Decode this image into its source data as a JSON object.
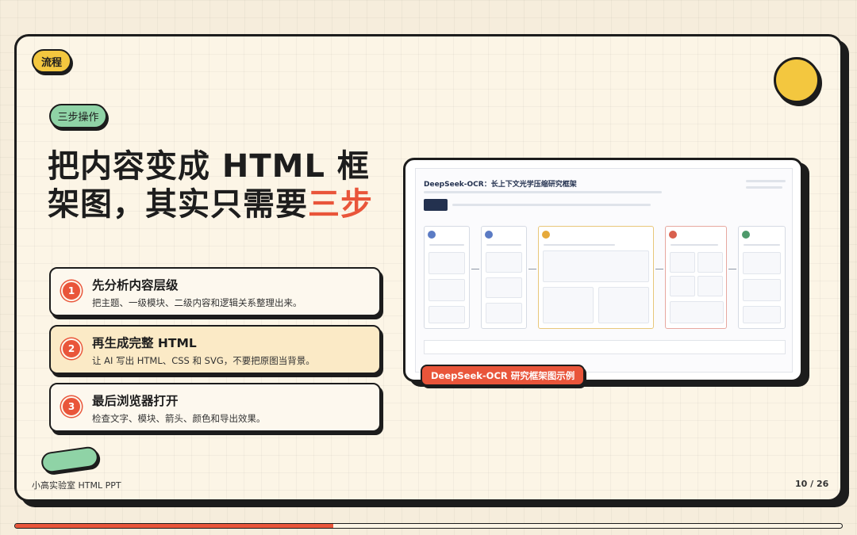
{
  "tag_label": "流程",
  "subtag_label": "三步操作",
  "headline": {
    "part1": "把内容变成 HTML 框架图，其实只需要",
    "accent": "三步"
  },
  "steps": [
    {
      "num": "1",
      "title": "先分析内容层级",
      "desc": "把主题、一级模块、二级内容和逻辑关系整理出来。"
    },
    {
      "num": "2",
      "title": "再生成完整 HTML",
      "desc": "让 AI 写出 HTML、CSS 和 SVG，不要把原图当背景。"
    },
    {
      "num": "3",
      "title": "最后浏览器打开",
      "desc": "检查文字、模块、箭头、颜色和导出效果。"
    }
  ],
  "preview": {
    "title": "DeepSeek-OCR：长上下文光学压缩研究框架",
    "caption": "DeepSeek-OCR 研究框架图示例"
  },
  "footer": {
    "brand": "小高实验室 HTML PPT",
    "page": "10 / 26"
  },
  "progress": {
    "current": 10,
    "total": 26
  },
  "colors": {
    "accent": "#e9553a",
    "yellow": "#f3c73f",
    "green": "#8fd3a6"
  }
}
